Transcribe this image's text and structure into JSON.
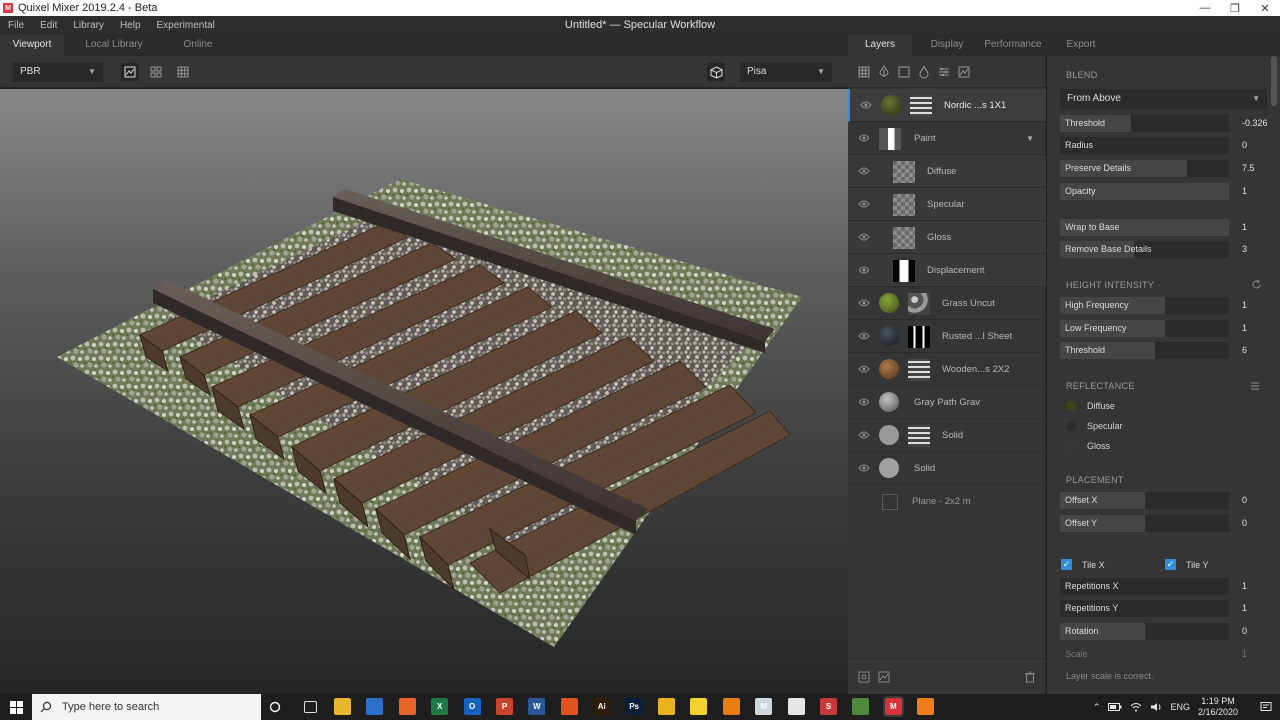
{
  "window": {
    "app_title": "Quixel Mixer 2019.2.4 - Beta",
    "doc_title": "Untitled* — Specular Workflow",
    "controls": [
      "—",
      "❐",
      "✕"
    ]
  },
  "menu": [
    "File",
    "Edit",
    "Library",
    "Help",
    "Experimental"
  ],
  "viewport_tabs": [
    "Viewport",
    "Local Library",
    "Online"
  ],
  "viewport_toolbar": {
    "render_mode": "PBR",
    "environment": "Pisa"
  },
  "panel_tabs": [
    "Layers",
    "Display",
    "Performance",
    "Export"
  ],
  "layers": [
    {
      "name": "Nordic ...s 1X1",
      "thumb": "#4d5320",
      "mask": "stripes",
      "selected": true
    },
    {
      "name": "Paint",
      "thumb": "",
      "mask": "halfwhite",
      "expandable": true
    },
    {
      "name": "Diffuse",
      "mask": "checker",
      "child": true
    },
    {
      "name": "Specular",
      "mask": "checker",
      "child": true
    },
    {
      "name": "Gloss",
      "mask": "checker",
      "child": true
    },
    {
      "name": "Displacement",
      "mask": "bars",
      "child": true
    },
    {
      "name": "Grass Uncut",
      "thumb": "#6a7f28",
      "mask": "noise"
    },
    {
      "name": "Rusted ...l Sheet",
      "thumb": "#2a3036",
      "mask": "bars"
    },
    {
      "name": "Wooden...s 2X2",
      "thumb": "#8a5a36",
      "mask": "stripes"
    },
    {
      "name": "Gray Path Grav",
      "thumb": "#8f8f8f",
      "mask": ""
    },
    {
      "name": "Solid",
      "thumb": "#9a9a9a",
      "mask": "stripes"
    },
    {
      "name": "Solid",
      "thumb": "#a1a1a1",
      "mask": ""
    },
    {
      "name": "Plane - 2x2 m",
      "thumb": "",
      "mask": "",
      "plane": true
    }
  ],
  "props": {
    "blend_title": "BLEND",
    "blend_mode": "From Above",
    "blend_rows": [
      {
        "label": "Threshold",
        "value": "-0.326",
        "fill": 0.42
      },
      {
        "label": "Radius",
        "value": "0",
        "fill": 0.0
      },
      {
        "label": "Preserve Details",
        "value": "7.5",
        "fill": 0.75
      },
      {
        "label": "Opacity",
        "value": "1",
        "fill": 1.0
      },
      {
        "label": "Wrap to Base",
        "value": "1",
        "fill": 1.0
      },
      {
        "label": "Remove Base Details",
        "value": "3",
        "fill": 0.44
      }
    ],
    "height_title": "HEIGHT INTENSITY",
    "height_rows": [
      {
        "label": "High Frequency",
        "value": "1",
        "fill": 0.62
      },
      {
        "label": "Low Frequency",
        "value": "1",
        "fill": 0.62
      },
      {
        "label": "Threshold",
        "value": "6",
        "fill": 0.56
      }
    ],
    "reflectance_title": "REFLECTANCE",
    "reflectance": [
      {
        "label": "Diffuse",
        "color": "#3e4416"
      },
      {
        "label": "Specular",
        "color": "#2d2d2d"
      },
      {
        "label": "Gloss",
        "color": "#353535"
      }
    ],
    "placement_title": "PLACEMENT",
    "placement_rows": [
      {
        "label": "Offset X",
        "value": "0",
        "fill": 0.5
      },
      {
        "label": "Offset Y",
        "value": "0",
        "fill": 0.5
      }
    ],
    "tile_x": "Tile X",
    "tile_y": "Tile Y",
    "tile_rows": [
      {
        "label": "Repetitions X",
        "value": "1",
        "fill": 0.0
      },
      {
        "label": "Repetitions Y",
        "value": "1",
        "fill": 0.0
      },
      {
        "label": "Rotation",
        "value": "0",
        "fill": 0.5
      }
    ],
    "scale_label": "Scale",
    "scale_value": "1",
    "scale_note": "Layer scale is correct."
  },
  "taskbar": {
    "search_placeholder": "Type here to search",
    "apps": [
      {
        "name": "task-view-icon",
        "color": "#1e1e1e",
        "glyph": ""
      },
      {
        "name": "file-explorer-icon",
        "color": "#e8b62c",
        "glyph": ""
      },
      {
        "name": "store-icon",
        "color": "#2a6fc9",
        "glyph": ""
      },
      {
        "name": "firefox-icon",
        "color": "#e8642b",
        "glyph": ""
      },
      {
        "name": "excel-icon",
        "color": "#1f7a44",
        "glyph": "X"
      },
      {
        "name": "outlook-icon",
        "color": "#1565c0",
        "glyph": "O"
      },
      {
        "name": "powerpoint-icon",
        "color": "#c9442a",
        "glyph": "P"
      },
      {
        "name": "word-icon",
        "color": "#2b5797",
        "glyph": "W"
      },
      {
        "name": "brave-icon",
        "color": "#e0531f",
        "glyph": ""
      },
      {
        "name": "illustrator-icon",
        "color": "#2e1c05",
        "glyph": "Ai"
      },
      {
        "name": "photoshop-icon",
        "color": "#0b1e3a",
        "glyph": "Ps"
      },
      {
        "name": "chrome-icon",
        "color": "#e8b31c",
        "glyph": ""
      },
      {
        "name": "sticky-notes-icon",
        "color": "#f2d22e",
        "glyph": ""
      },
      {
        "name": "blender-icon",
        "color": "#e87d0d",
        "glyph": ""
      },
      {
        "name": "mixer-bridge-icon",
        "color": "#cfd8dc",
        "glyph": "M"
      },
      {
        "name": "unreal-icon",
        "color": "#e6e6e6",
        "glyph": ""
      },
      {
        "name": "substance-icon",
        "color": "#c73a3a",
        "glyph": "S"
      },
      {
        "name": "minecraft-icon",
        "color": "#4f8a3c",
        "glyph": ""
      },
      {
        "name": "quixel-mixer-icon",
        "color": "#d9343b",
        "glyph": "M"
      },
      {
        "name": "vlc-icon",
        "color": "#ef7e16",
        "glyph": ""
      }
    ],
    "language": "ENG",
    "time": "1:19 PM",
    "date": "2/16/2020"
  }
}
